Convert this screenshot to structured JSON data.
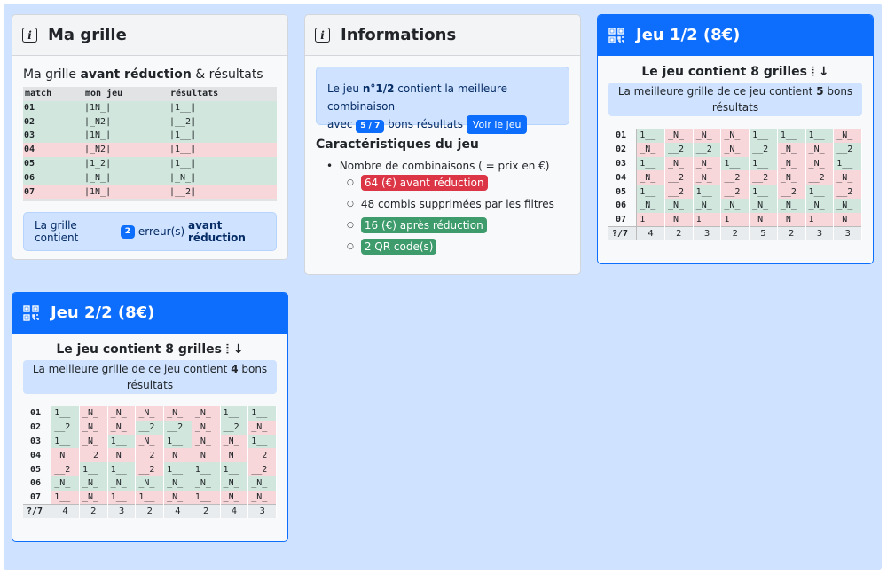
{
  "ma_grille": {
    "title": "Ma grille",
    "subtitle_prefix": "Ma grille ",
    "subtitle_bold": "avant réduction",
    "subtitle_suffix": " & résultats",
    "header": [
      "match",
      "mon jeu",
      "résultats"
    ],
    "rows": [
      {
        "match": "01",
        "jeu": "|1N_|",
        "res": "|1__|",
        "ok": true
      },
      {
        "match": "02",
        "jeu": "|_N2|",
        "res": "|__2|",
        "ok": true
      },
      {
        "match": "03",
        "jeu": "|1N_|",
        "res": "|1__|",
        "ok": true
      },
      {
        "match": "04",
        "jeu": "|_N2|",
        "res": "|1__|",
        "ok": false
      },
      {
        "match": "05",
        "jeu": "|1_2|",
        "res": "|1__|",
        "ok": true
      },
      {
        "match": "06",
        "jeu": "|_N_|",
        "res": "|_N_|",
        "ok": true
      },
      {
        "match": "07",
        "jeu": "|1N_|",
        "res": "|__2|",
        "ok": false
      }
    ],
    "alert_prefix": "La grille contient",
    "alert_count": "2",
    "alert_mid": "erreur(s)",
    "alert_bold": "avant réduction"
  },
  "informations": {
    "title": "Informations",
    "line1_prefix": "Le jeu ",
    "line1_bold": "n°1/2",
    "line1_suffix": " contient la meilleure combinaison",
    "line2_prefix": "avec",
    "badge": "5 / 7",
    "line2_suffix": "bons résultats",
    "button": "Voir le jeu",
    "carac_title": "Caractéristiques du jeu",
    "bullet": "Nombre de combinaisons ( = prix en €)",
    "items": [
      {
        "text": "64 (€) avant réduction",
        "style": "red"
      },
      {
        "text": "48 combis supprimées par les filtres",
        "style": "plain"
      },
      {
        "text": "16 (€) après réduction",
        "style": "green"
      },
      {
        "text": "2 QR code(s)",
        "style": "green"
      }
    ]
  },
  "jeux": [
    {
      "title": "Jeu 1/2 (8€)",
      "head": "Le jeu contient 8 grilles ⦙ ↓",
      "best_prefix": "La meilleure grille de ce jeu contient ",
      "best_count": "5",
      "best_suffix": " bons résultats",
      "matches": [
        "01",
        "02",
        "03",
        "04",
        "05",
        "06",
        "07"
      ],
      "cells": [
        [
          "1__",
          "_N_",
          "_N_",
          "_N_",
          "1__",
          "1__",
          "1__",
          "_N_"
        ],
        [
          "_N_",
          "__2",
          "__2",
          "_N_",
          "__2",
          "_N_",
          "_N_",
          "__2"
        ],
        [
          "1__",
          "_N_",
          "_N_",
          "1__",
          "1__",
          "_N_",
          "_N_",
          "1__"
        ],
        [
          "_N_",
          "__2",
          "_N_",
          "__2",
          "__2",
          "_N_",
          "__2",
          "_N_"
        ],
        [
          "1__",
          "__2",
          "1__",
          "__2",
          "1__",
          "__2",
          "1__",
          "__2"
        ],
        [
          "_N_",
          "_N_",
          "_N_",
          "_N_",
          "_N_",
          "_N_",
          "_N_",
          "_N_"
        ],
        [
          "1__",
          "_N_",
          "1__",
          "1__",
          "_N_",
          "_N_",
          "1__",
          "_N_"
        ]
      ],
      "ok": [
        [
          1,
          0,
          0,
          0,
          1,
          1,
          1,
          0
        ],
        [
          0,
          1,
          1,
          0,
          1,
          0,
          0,
          1
        ],
        [
          1,
          0,
          0,
          1,
          1,
          0,
          0,
          1
        ],
        [
          0,
          0,
          0,
          0,
          0,
          0,
          0,
          0
        ],
        [
          1,
          0,
          1,
          0,
          1,
          0,
          1,
          0
        ],
        [
          1,
          1,
          1,
          1,
          1,
          1,
          1,
          1
        ],
        [
          0,
          0,
          0,
          0,
          0,
          0,
          0,
          0
        ]
      ],
      "total_label": "?/7",
      "totals": [
        "4",
        "2",
        "3",
        "2",
        "5",
        "2",
        "3",
        "3"
      ]
    },
    {
      "title": "Jeu 2/2 (8€)",
      "head": "Le jeu contient 8 grilles ⦙ ↓",
      "best_prefix": "La meilleure grille de ce jeu contient ",
      "best_count": "4",
      "best_suffix": " bons résultats",
      "matches": [
        "01",
        "02",
        "03",
        "04",
        "05",
        "06",
        "07"
      ],
      "cells": [
        [
          "1__",
          "_N_",
          "_N_",
          "_N_",
          "_N_",
          "_N_",
          "1__",
          "1__"
        ],
        [
          "__2",
          "_N_",
          "_N_",
          "__2",
          "__2",
          "_N_",
          "__2",
          "_N_"
        ],
        [
          "1__",
          "_N_",
          "1__",
          "_N_",
          "1__",
          "_N_",
          "_N_",
          "1__"
        ],
        [
          "_N_",
          "__2",
          "_N_",
          "__2",
          "_N_",
          "_N_",
          "_N_",
          "__2"
        ],
        [
          "__2",
          "1__",
          "1__",
          "__2",
          "1__",
          "1__",
          "1__",
          "__2"
        ],
        [
          "_N_",
          "_N_",
          "_N_",
          "_N_",
          "_N_",
          "_N_",
          "_N_",
          "_N_"
        ],
        [
          "1__",
          "_N_",
          "1__",
          "1__",
          "_N_",
          "1__",
          "_N_",
          "_N_"
        ]
      ],
      "ok": [
        [
          1,
          0,
          0,
          0,
          0,
          0,
          1,
          1
        ],
        [
          1,
          0,
          0,
          1,
          1,
          0,
          1,
          0
        ],
        [
          1,
          0,
          1,
          0,
          1,
          0,
          0,
          1
        ],
        [
          0,
          0,
          0,
          0,
          0,
          0,
          0,
          0
        ],
        [
          0,
          1,
          1,
          0,
          1,
          1,
          1,
          0
        ],
        [
          1,
          1,
          1,
          1,
          1,
          1,
          1,
          1
        ],
        [
          0,
          0,
          0,
          0,
          0,
          0,
          0,
          0
        ]
      ],
      "total_label": "?/7",
      "totals": [
        "4",
        "2",
        "3",
        "2",
        "4",
        "2",
        "4",
        "3"
      ]
    }
  ]
}
